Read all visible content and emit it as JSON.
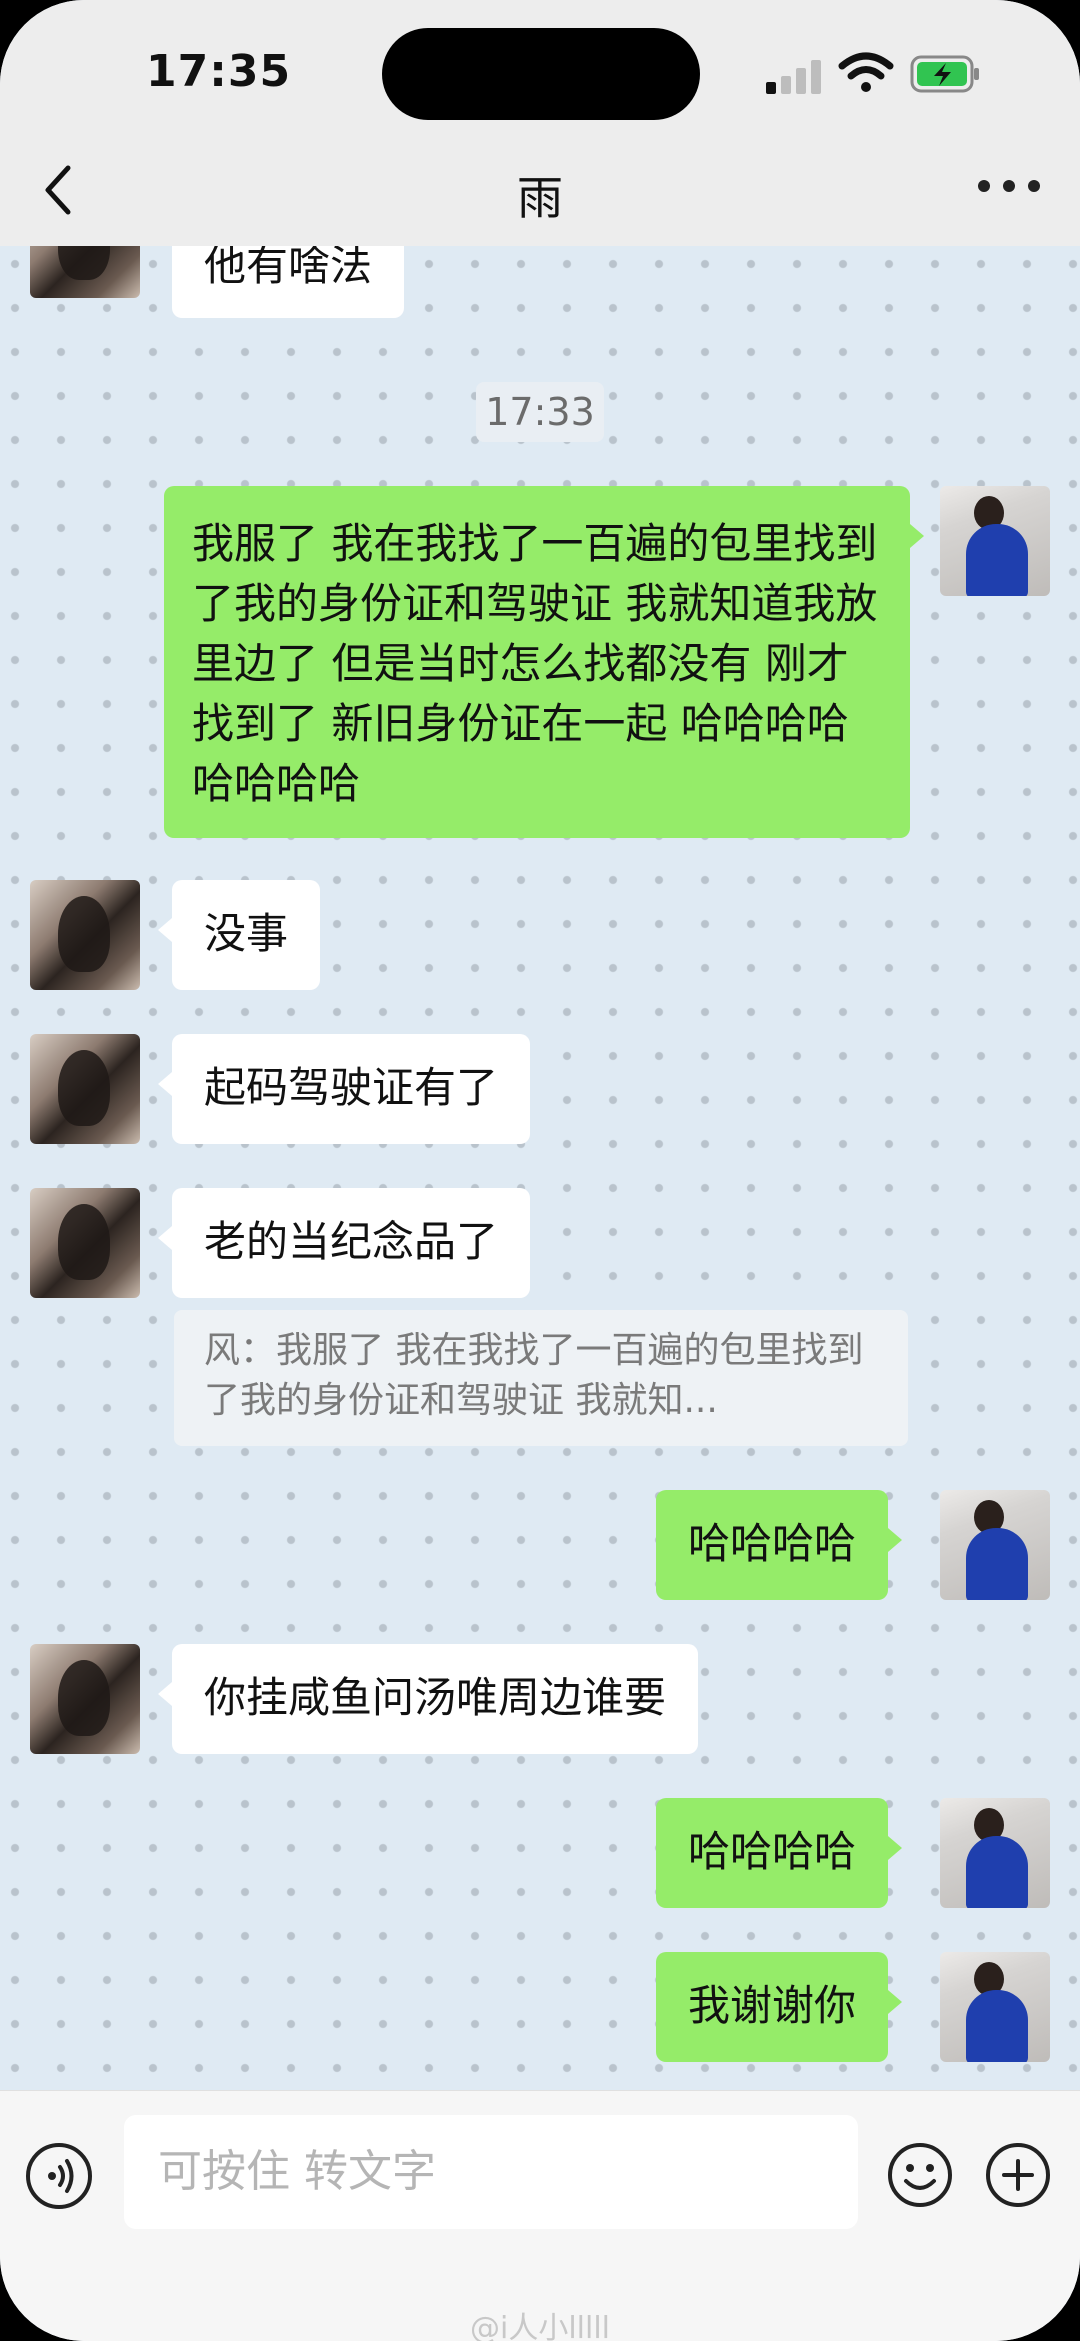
{
  "status_bar": {
    "time": "17:35"
  },
  "header": {
    "title": "雨"
  },
  "messages": [
    {
      "side": "in",
      "text": "他有啥法"
    },
    {
      "side": "time",
      "text": "17:33"
    },
    {
      "side": "out",
      "text": "我服了 我在我找了一百遍的包里找到了我的身份证和驾驶证 我就知道我放里边了 但是当时怎么找都没有 刚才找到了 新旧身份证在一起 哈哈哈哈哈哈哈哈"
    },
    {
      "side": "in",
      "text": "没事"
    },
    {
      "side": "in",
      "text": "起码驾驶证有了"
    },
    {
      "side": "in",
      "text": "老的当纪念品了"
    },
    {
      "side": "quote",
      "text": "风：我服了 我在我找了一百遍的包里找到了我的身份证和驾驶证 我就知..."
    },
    {
      "side": "out",
      "text": "哈哈哈哈"
    },
    {
      "side": "in",
      "text": "你挂咸鱼问汤唯周边谁要"
    },
    {
      "side": "out",
      "text": "哈哈哈哈"
    },
    {
      "side": "out",
      "text": "我谢谢你"
    }
  ],
  "input": {
    "placeholder": "可按住 转文字"
  },
  "watermark": "@i人小lllll",
  "icons": {
    "back": "chevron-left-icon",
    "more": "more-dots-icon",
    "voice": "voice-icon",
    "emoji": "emoji-icon",
    "plus": "plus-icon"
  },
  "colors": {
    "outgoing_bubble": "#95ec69",
    "incoming_bubble": "#ffffff",
    "chat_background": "#dfeaf3"
  }
}
